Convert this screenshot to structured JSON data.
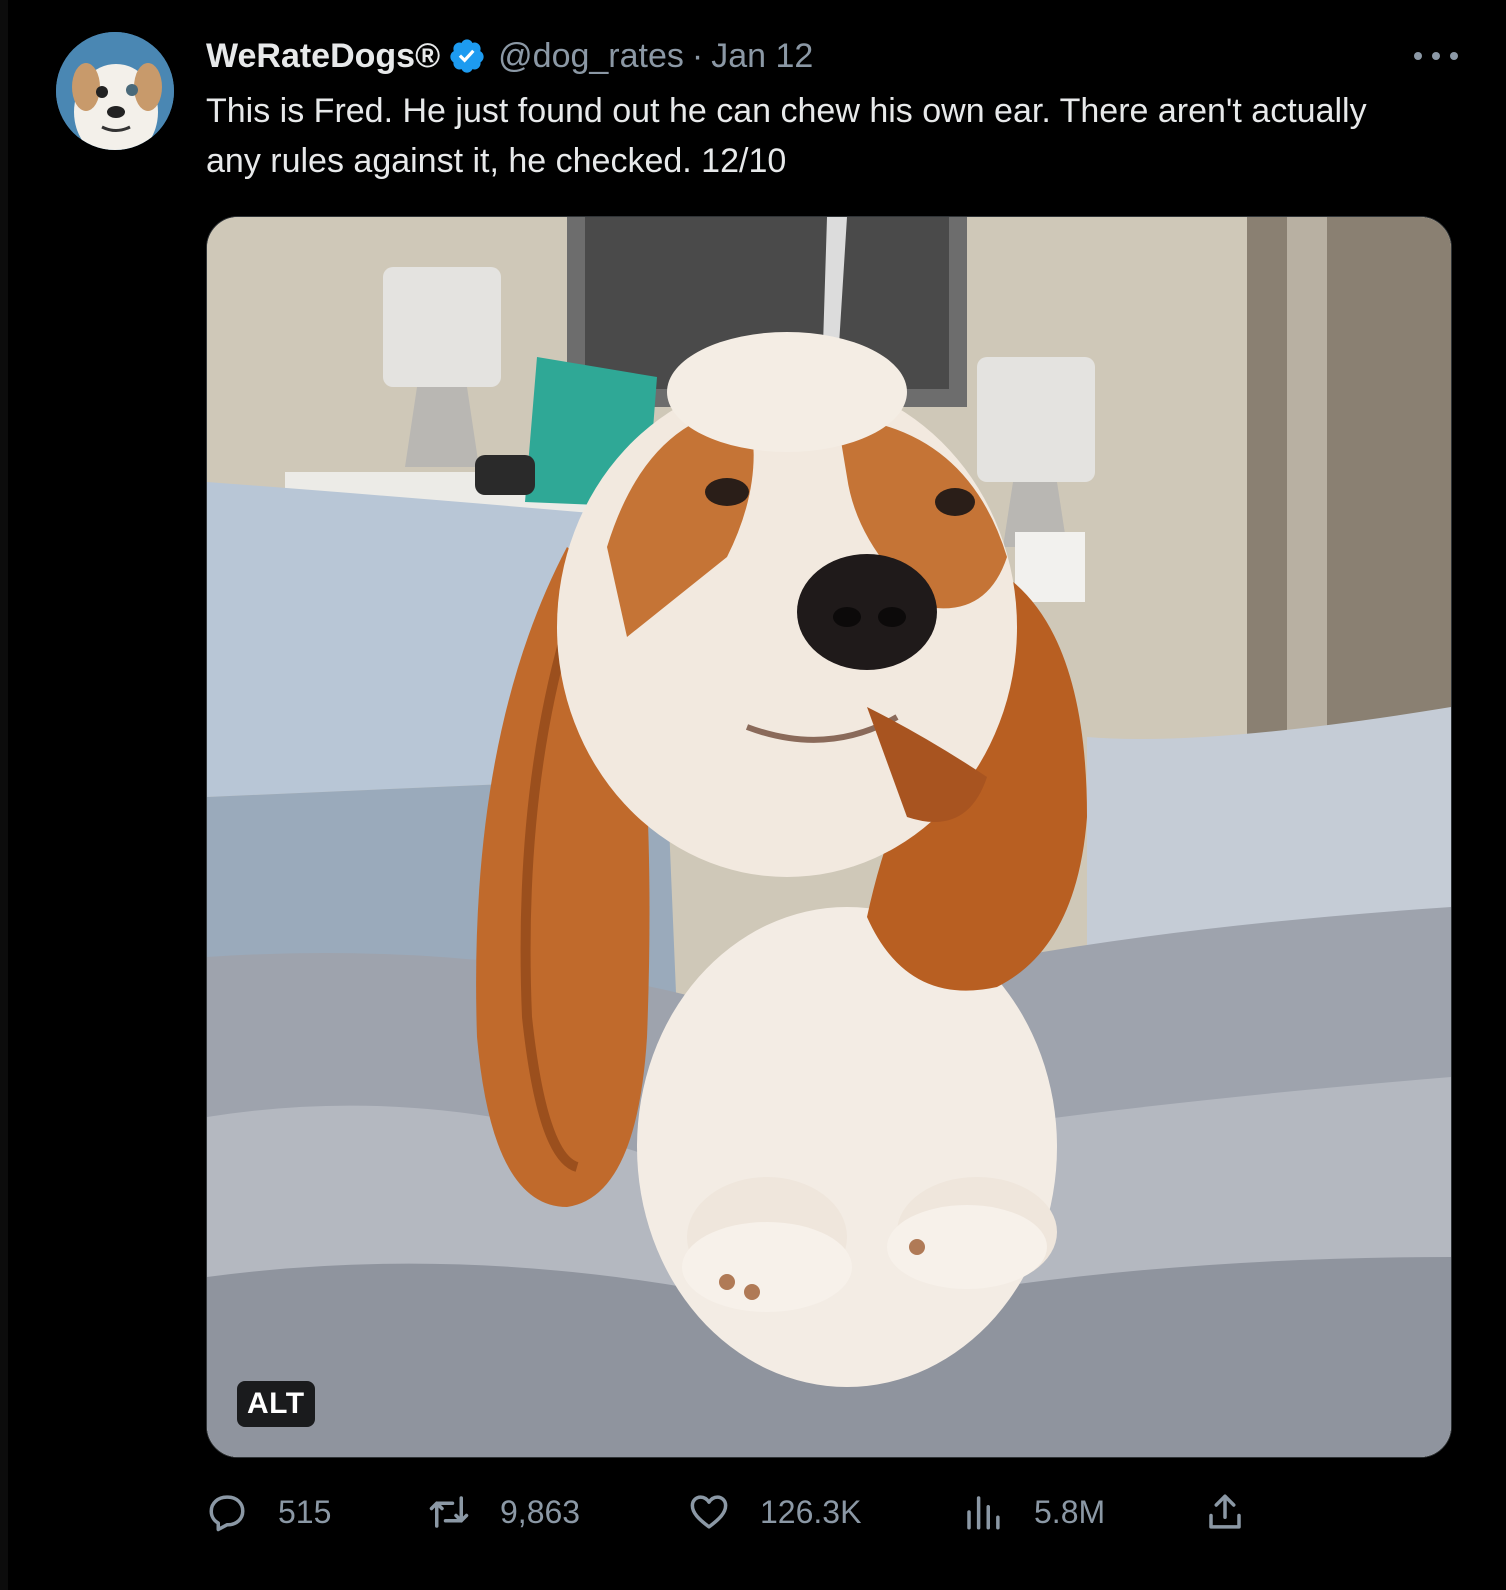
{
  "tweet": {
    "author_name": "WeRateDogs®",
    "handle": "@dog_rates",
    "separator": "·",
    "date": "Jan 12",
    "text": "This is Fred. He just found out he can chew his own ear. There aren't actually any rules against it, he checked. 12/10",
    "media": {
      "alt_badge": "ALT"
    },
    "actions": {
      "replies": "515",
      "retweets": "9,863",
      "likes": "126.3K",
      "views": "5.8M"
    }
  },
  "icons": {
    "verified": "verified-badge-icon",
    "more": "more-options-icon",
    "reply": "reply-icon",
    "retweet": "retweet-icon",
    "like": "heart-icon",
    "views": "views-chart-icon",
    "share": "share-icon"
  },
  "colors": {
    "background": "#000000",
    "text_primary": "#e7e9ea",
    "text_secondary": "#8b98a5",
    "verified_blue": "#1d9bf0"
  }
}
